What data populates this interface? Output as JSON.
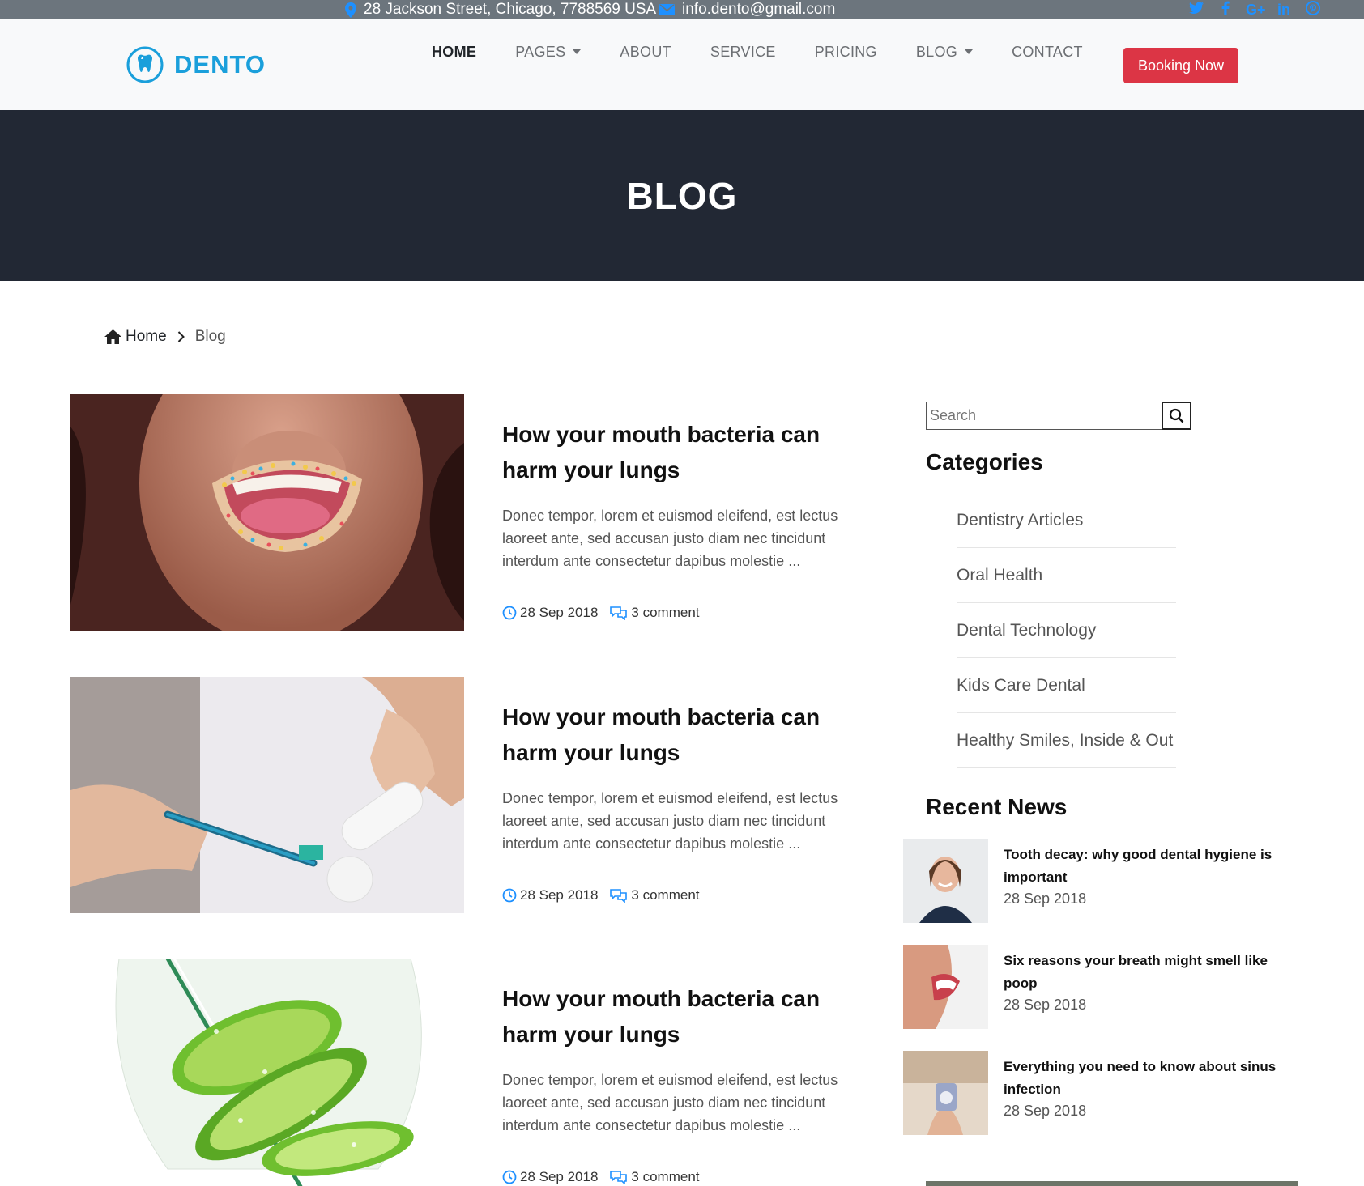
{
  "topbar": {
    "address": "28 Jackson Street, Chicago, 7788569 USA",
    "email": "info.dento@gmail.com",
    "social_icons": [
      "twitter-icon",
      "facebook-icon",
      "google-plus-icon",
      "linkedin-icon",
      "pinterest-icon"
    ]
  },
  "brand": {
    "name": "DENTO"
  },
  "nav": {
    "items": [
      {
        "label": "HOME"
      },
      {
        "label": "PAGES"
      },
      {
        "label": "ABOUT"
      },
      {
        "label": "SERVICE"
      },
      {
        "label": "PRICING"
      },
      {
        "label": "BLOG"
      },
      {
        "label": "CONTACT"
      }
    ],
    "cta": "Booking Now"
  },
  "hero": {
    "title": "BLOG"
  },
  "breadcrumb": {
    "home": "Home",
    "current": "Blog"
  },
  "posts": [
    {
      "title": "How your mouth bacteria can harm your lungs",
      "excerpt": "Donec tempor, lorem et euismod eleifend, est lectus laoreet ante, sed accusan justo diam nec tincidunt interdum ante consectetur dapibus molestie ...",
      "date": "28 Sep 2018",
      "comments": "3 comment"
    },
    {
      "title": "How your mouth bacteria can harm your lungs",
      "excerpt": "Donec tempor, lorem et euismod eleifend, est lectus laoreet ante, sed accusan justo diam nec tincidunt interdum ante consectetur dapibus molestie ...",
      "date": "28 Sep 2018",
      "comments": "3 comment"
    },
    {
      "title": "How your mouth bacteria can harm your lungs",
      "excerpt": "Donec tempor, lorem et euismod eleifend, est lectus laoreet ante, sed accusan justo diam nec tincidunt interdum ante consectetur dapibus molestie ...",
      "date": "28 Sep 2018",
      "comments": "3 comment"
    }
  ],
  "sidebar": {
    "search_placeholder": "Search",
    "categories_title": "Categories",
    "categories": [
      "Dentistry Articles",
      "Oral Health",
      "Dental Technology",
      "Kids Care Dental",
      "Healthy Smiles, Inside & Out"
    ],
    "recent_title": "Recent News",
    "recent": [
      {
        "title": "Tooth decay: why good dental hygiene is important",
        "date": "28 Sep 2018"
      },
      {
        "title": "Six reasons your breath might smell like poop",
        "date": "28 Sep 2018"
      },
      {
        "title": "Everything you need to know about sinus infection",
        "date": "28 Sep 2018"
      }
    ]
  },
  "colors": {
    "brand_blue": "#1a9fdb",
    "cta_red": "#dc3545",
    "hero_bg": "#222834",
    "topbar_bg": "#6c757d",
    "accent_blue": "#1e90ff"
  }
}
